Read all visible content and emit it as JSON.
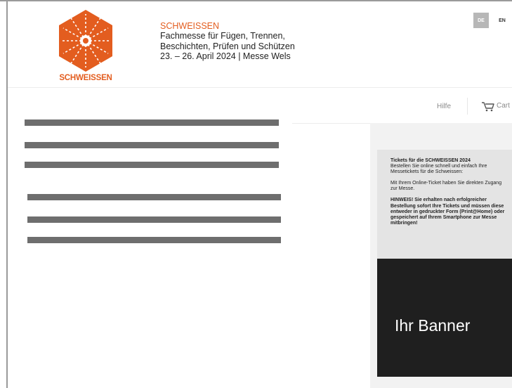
{
  "brand": {
    "logo_text": "SCHWEISSEN",
    "accent_color": "#e35d1f"
  },
  "event": {
    "name": "SCHWEISSEN",
    "tagline_line1": "Fachmesse für Fügen, Trennen,",
    "tagline_line2": "Beschichten, Prüfen und Schützen",
    "dates": "23. – 26. April 2024 | Messe Wels"
  },
  "language": {
    "options": [
      "DE",
      "EN"
    ],
    "active": "DE"
  },
  "nav": {
    "help_label": "Hilfe",
    "cart_label": "Cart",
    "cart_icon": "shopping-cart-icon"
  },
  "info_box": {
    "heading": "Tickets für die SCHWEISSEN 2024",
    "intro": "Bestellen Sie online schnell und einfach Ihre Messetickets für die Schweissen:",
    "access_note": "Mit Ihrem Online-Ticket haben Sie direkten Zugang zur Messe.",
    "notice": "HINWEIS! Sie erhalten nach erfolgreicher Bestellung sofort Ihre Tickets und müssen diese entweder in gedruckter Form (Print@Home) oder gespeichert auf Ihrem Smartphone zur Messe mitbringen!"
  },
  "banner": {
    "label": "Ihr Banner"
  }
}
